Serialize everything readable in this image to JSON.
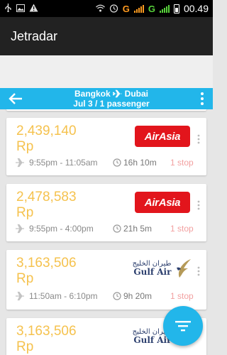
{
  "status_bar": {
    "icons": [
      "usb-icon",
      "image-icon",
      "warning-icon",
      "wifi-icon",
      "alarm-icon"
    ],
    "network_left": "G",
    "network_right": "G",
    "time": "00.49",
    "colors": {
      "network_left": "#ff9a1f",
      "network_right": "#58d23b"
    }
  },
  "app_bar": {
    "title": "Jetradar"
  },
  "route_header": {
    "origin": "Bangkok",
    "destination": "Dubai",
    "details": "Jul 3 / 1 passenger",
    "back_icon": "back-arrow-icon",
    "more_icon": "more-vert-icon",
    "color": "#22b6ea"
  },
  "flights": [
    {
      "price": "2,439,140",
      "currency": "Rp",
      "airline": "AirAsia",
      "logo_text": "AirAsia",
      "times": "9:55pm - 11:05am",
      "duration": "16h 10m",
      "stops": "1 stop"
    },
    {
      "price": "2,478,583",
      "currency": "Rp",
      "airline": "AirAsia",
      "logo_text": "AirAsia",
      "times": "9:55pm - 4:00pm",
      "duration": "21h 5m",
      "stops": "1 stop"
    },
    {
      "price": "3,163,506",
      "currency": "Rp",
      "airline": "Gulf Air",
      "logo_text": "Gulf Air",
      "logo_arabic": "طيران الخليج",
      "times": "11:50am - 6:10pm",
      "duration": "9h 20m",
      "stops": "1 stop"
    },
    {
      "price": "3,163,506",
      "currency": "Rp",
      "airline": "Gulf Air",
      "logo_text": "Gulf Air",
      "logo_arabic": "طيران الخليج"
    }
  ],
  "fab": {
    "icon": "filter-icon",
    "color": "#22b6ea"
  },
  "colors": {
    "price": "#f5c24e",
    "stops": "#f2a0a0",
    "airasia_red": "#e2151c",
    "gulf_blue": "#2c3f6e"
  }
}
